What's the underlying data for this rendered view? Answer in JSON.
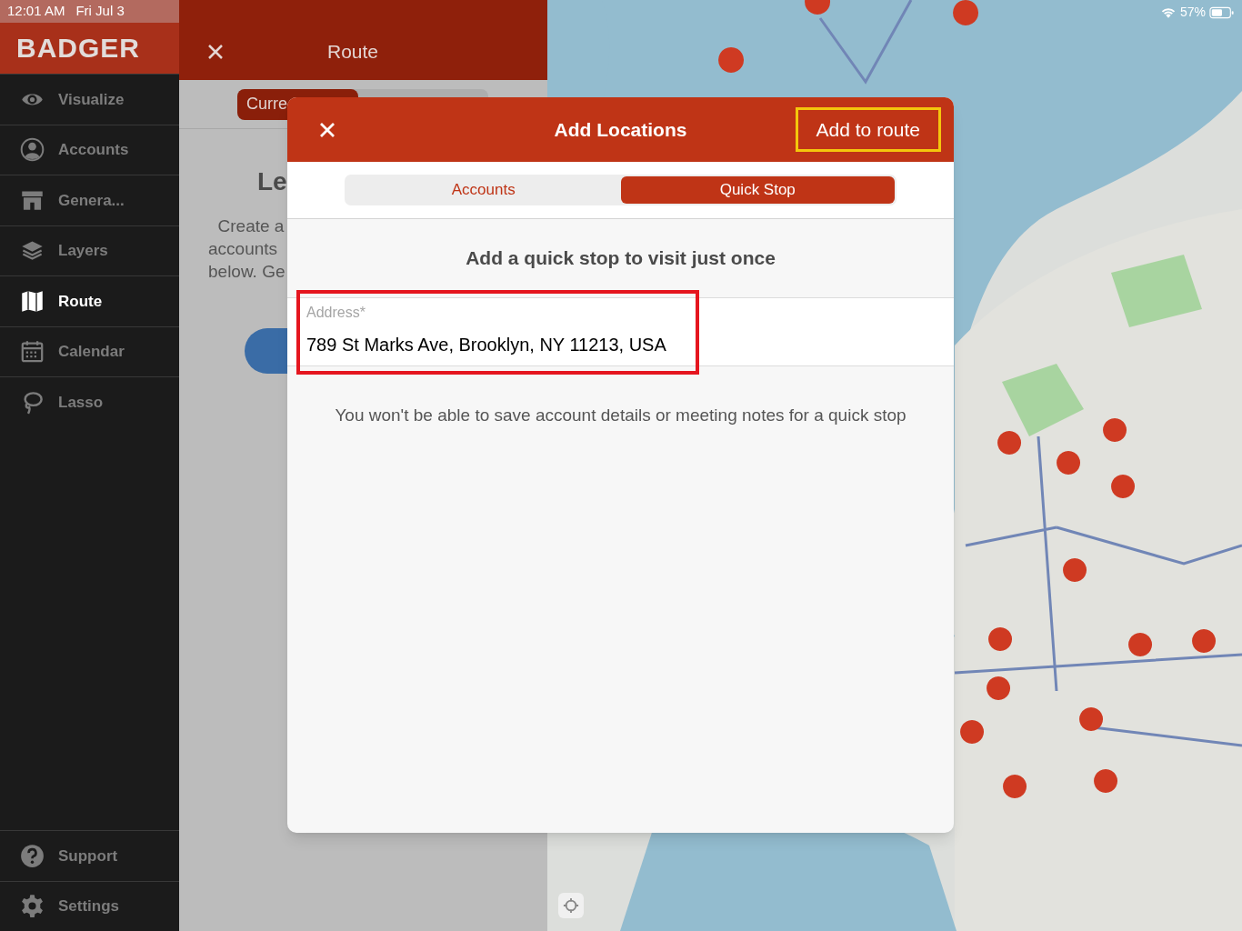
{
  "status_bar": {
    "time": "12:01 AM",
    "date": "Fri Jul 3",
    "battery": "57%"
  },
  "sidebar": {
    "logo": "BADGER",
    "items": [
      {
        "label": "Visualize",
        "selected": false
      },
      {
        "label": "Accounts",
        "selected": false
      },
      {
        "label": "Genera...",
        "selected": false
      },
      {
        "label": "Layers",
        "selected": false
      },
      {
        "label": "Route",
        "selected": true
      },
      {
        "label": "Calendar",
        "selected": false
      },
      {
        "label": "Lasso",
        "selected": false
      }
    ],
    "footer_items": [
      {
        "label": "Support",
        "selected": false
      },
      {
        "label": "Settings",
        "selected": false
      }
    ]
  },
  "route_panel": {
    "title": "Route",
    "tabs": [
      {
        "label": "Curre",
        "selected": true
      }
    ],
    "heading": "Le",
    "description": [
      "Create a",
      "accounts",
      "below. Ge"
    ]
  },
  "modal": {
    "title": "Add Locations",
    "action": {
      "label": "Add to route",
      "highlighted": true
    },
    "tabs": [
      {
        "label": "Accounts",
        "selected": false
      },
      {
        "label": "Quick Stop",
        "selected": true
      }
    ],
    "heading": "Add a quick stop to visit just once",
    "address": {
      "label": "Address*",
      "value": "789 St Marks Ave, Brooklyn, NY 11213, USA",
      "highlighted": true
    },
    "note": "You won't be able to save account details or meeting notes for a quick stop"
  }
}
